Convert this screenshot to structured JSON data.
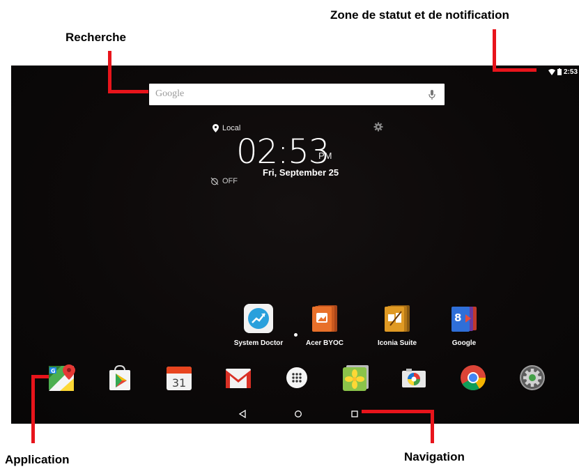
{
  "callouts": {
    "status_zone": "Zone de statut et de notification",
    "search": "Recherche",
    "application": "Application",
    "navigation": "Navigation"
  },
  "status_bar": {
    "time": "2:53"
  },
  "search": {
    "placeholder": "Google"
  },
  "clock_widget": {
    "location": "Local",
    "time": "02:53",
    "ampm": "PM",
    "date": "Fri, September 25",
    "alarm": "OFF"
  },
  "apps": [
    {
      "label": "System Doctor"
    },
    {
      "label": "Acer BYOC"
    },
    {
      "label": "Iconia Suite"
    },
    {
      "label": "Google"
    }
  ],
  "dock": [
    "maps-icon",
    "play-store-icon",
    "calendar-icon",
    "gmail-icon",
    "app-drawer-icon",
    "photos-icon",
    "camera-icon",
    "chrome-icon",
    "settings-icon"
  ],
  "calendar_day": "31",
  "colors": {
    "annotation_red": "#e8141b",
    "screen_bg": "#0c0909"
  }
}
